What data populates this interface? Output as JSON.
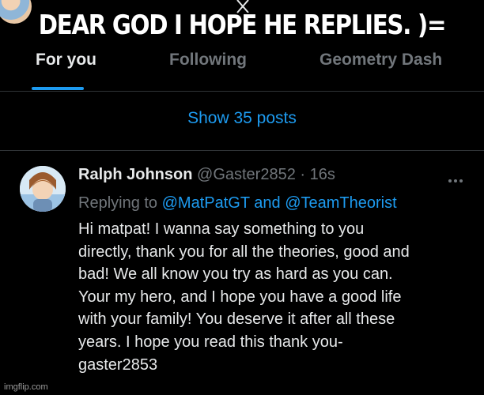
{
  "caption": "DEAR GOD I HOPE HE REPLIES. )=",
  "tabs": [
    {
      "label": "For you",
      "active": true
    },
    {
      "label": "Following",
      "active": false
    },
    {
      "label": "Geometry Dash",
      "active": false
    }
  ],
  "show_posts_label": "Show 35 posts",
  "post": {
    "author_name": "Ralph Johnson",
    "author_handle": "@Gaster2852",
    "separator": "·",
    "timestamp": "16s",
    "replying_prefix": "Replying to",
    "replying_to_1": "@MatPatGT",
    "replying_and": "and",
    "replying_to_2": "@TeamTheorist",
    "body_lines": [
      "Hi matpat! I wanna say something to you",
      "directly, thank you for all the theories, good and",
      "bad! We all know you try as hard as you can.",
      "Your my hero, and I hope you have a good life",
      "with your family! You deserve it after all these",
      "years. I hope you read this thank you-",
      "gaster2853"
    ]
  },
  "watermark": "imgflip.com",
  "colors": {
    "background": "#000000",
    "text": "#e7e9ea",
    "muted": "#71767b",
    "accent": "#1d9bf0",
    "divider": "#2f3336"
  },
  "icons": {
    "top_logo": "x-logo-icon",
    "more": "more-options-icon"
  }
}
